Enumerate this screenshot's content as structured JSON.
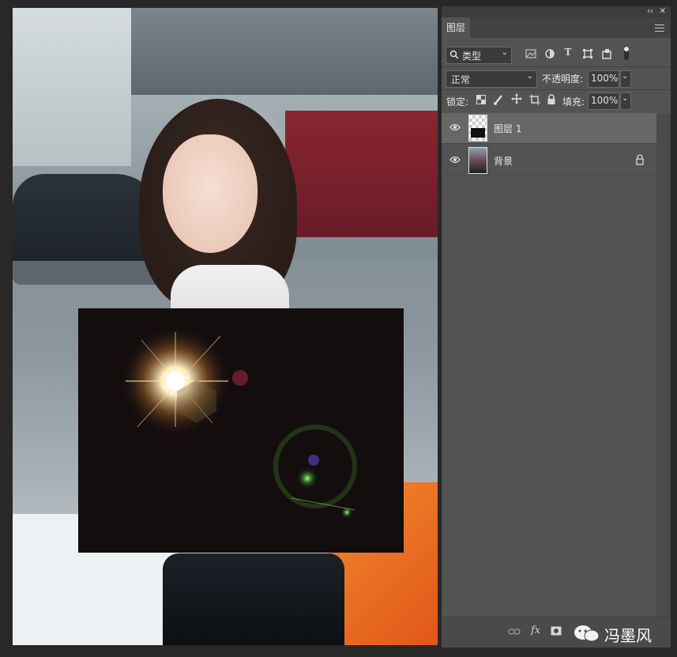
{
  "panel": {
    "tab_label": "图层",
    "collapse_icon": "double-chevron-icon",
    "close_icon": "close-icon",
    "filter": {
      "search_icon": "search-icon",
      "value": "类型"
    },
    "blend_mode": "正常",
    "opacity_label": "不透明度:",
    "opacity_value": "100%",
    "lock_label": "锁定:",
    "fill_label": "填充:",
    "fill_value": "100%",
    "layers": [
      {
        "name": "图层 1",
        "visible": true,
        "selected": true
      },
      {
        "name": "背景",
        "visible": true,
        "locked": true
      }
    ],
    "bottom": {
      "fx": "fx",
      "watermark": "冯墨风"
    }
  },
  "colors": {
    "panel_bg": "#535353",
    "selected_row": "#676767",
    "flare_bg": "#140d0e"
  }
}
